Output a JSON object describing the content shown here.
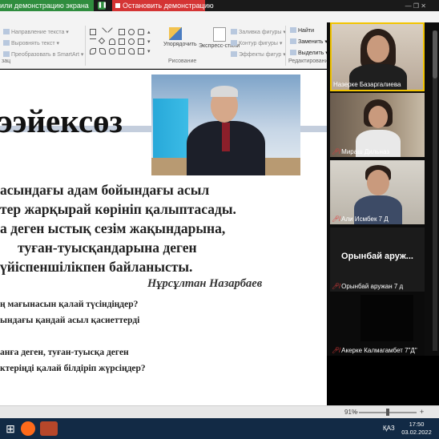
{
  "share_bar": {
    "label": "или демонстрацию экрана",
    "stop_button": "Остановить демонстрацию"
  },
  "ribbon": {
    "paragraph_items": [
      "Направление текста",
      "Выровнять текст",
      "Преобразовать в SmartArt"
    ],
    "paragraph_group_fragment": "зац",
    "arrange_label": "Упорядочить",
    "quick_styles_label": "Экспресс-стили",
    "drawing_group_label": "Рисование",
    "format_items": [
      "Заливка фигуры",
      "Контур фигуры",
      "Эффекты фигур"
    ],
    "editing_items": [
      "Найти",
      "Заменить",
      "Выделить"
    ],
    "editing_group_label": "Редактирование"
  },
  "slide": {
    "title": "ээйексөз",
    "body_lines": [
      "асындағы адам бойындағы асыл",
      "тер жарқырай көрініп қалыптасады.",
      "а деген ыстық сезім жақындарына,",
      "туған-туысқандарына деген",
      "үйіспеншілікпен байланысты."
    ],
    "author": "Нұрсұлтан Назарбаев",
    "questions": [
      "ң мағынасын қалай түсіндіңдер?",
      "ындағы қандай асыл қасиеттерді",
      "",
      "анға деген, туған-туысқа деген",
      "ктеріңді қалай білдіріп жүрсіңдер?"
    ]
  },
  "participants": [
    {
      "name": "Назерке Базаргалиева",
      "muted": false,
      "active": true
    },
    {
      "name": "Мираш Дильназ",
      "muted": true,
      "active": false
    },
    {
      "name": "Али Исмбек 7 Д",
      "muted": true,
      "active": false
    },
    {
      "name": "Орынбай аружан 7 д",
      "muted": true,
      "active": false,
      "display_text": "Орынбай аруж..."
    },
    {
      "name": "Акерке Калмагамбет 7\"Д\"",
      "muted": true,
      "active": false
    }
  ],
  "status": {
    "zoom_value": "91%",
    "zoom_level": 0.5
  },
  "taskbar": {
    "language": "ҚАЗ",
    "time": "17:50",
    "date": "03.02.2022"
  },
  "colors": {
    "share_green": "#2f8d3e",
    "stop_red": "#d43434",
    "active_speaker": "#f2c400",
    "muted_red": "#e23b3b",
    "taskbar": "#122a45"
  }
}
